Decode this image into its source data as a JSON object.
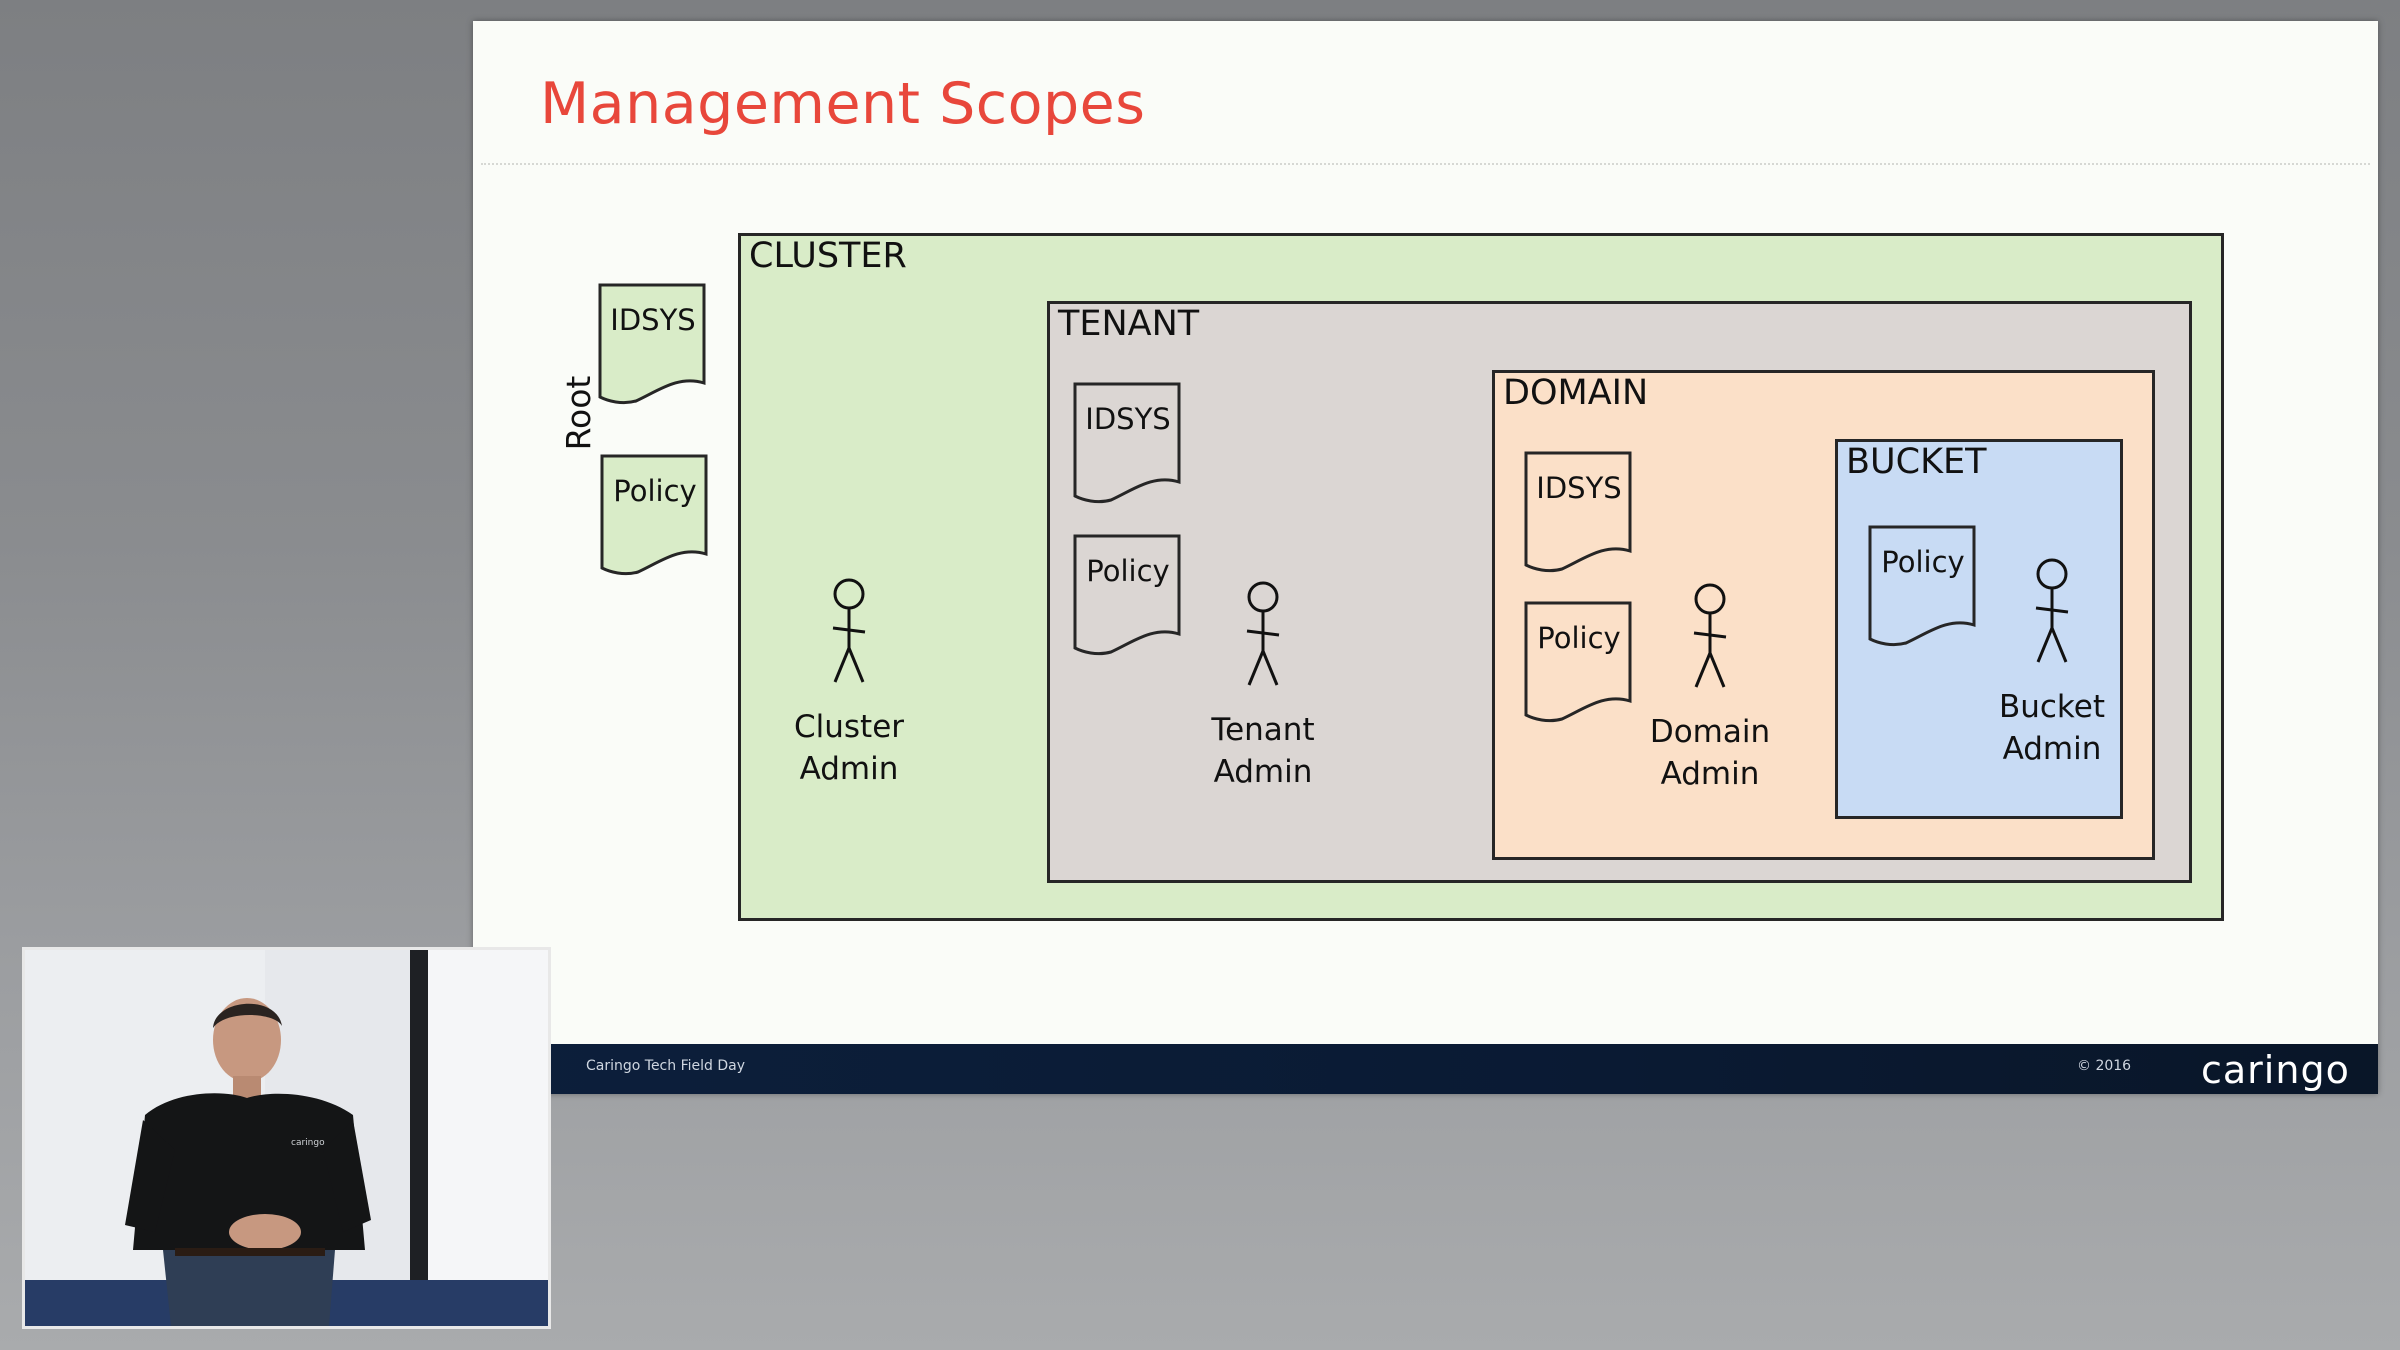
{
  "slide": {
    "title": "Management Scopes",
    "root_label": "Root",
    "root_docs": [
      "IDSYS",
      "Policy"
    ]
  },
  "scopes": {
    "cluster": {
      "label": "CLUSTER",
      "color": "#d9ecc8",
      "actor": [
        "Cluster",
        "Admin"
      ]
    },
    "tenant": {
      "label": "TENANT",
      "color": "#dbd6d3",
      "docs": [
        "IDSYS",
        "Policy"
      ],
      "actor": [
        "Tenant",
        "Admin"
      ]
    },
    "domain": {
      "label": "DOMAIN",
      "color": "#fbe0c8",
      "docs": [
        "IDSYS",
        "Policy"
      ],
      "actor": [
        "Domain",
        "Admin"
      ]
    },
    "bucket": {
      "label": "BUCKET",
      "color": "#c8dbf4",
      "docs": [
        "Policy"
      ],
      "actor": [
        "Bucket",
        "Admin"
      ]
    }
  },
  "footer": {
    "left_text": "Caringo Tech Field Day",
    "copyright": "© 2016",
    "logo": "caringo",
    "bar_color": "#0c1f3b"
  },
  "presenter": {
    "shirt_logo": "caringo"
  }
}
